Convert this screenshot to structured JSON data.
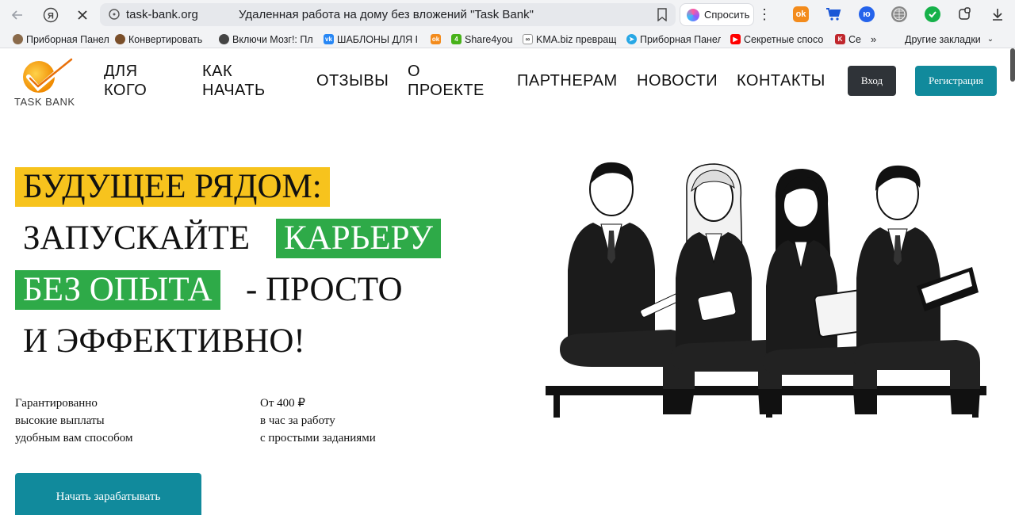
{
  "browser": {
    "url": "task-bank.org",
    "page_title": "Удаленная работа на дому без вложений \"Task Bank\"",
    "ask_label": "Спросить",
    "bookmarks": [
      "Приборная Панел",
      "Конвертировать ",
      "Включи Мозг!: Пл",
      "ШАБЛОНЫ ДЛЯ Р",
      "",
      "Share4you",
      "KMA.biz превращ",
      "Приборная Панел",
      "Секретные спосо",
      "Се",
      "Другие закладки"
    ]
  },
  "site": {
    "logo_text": "TASK BANK",
    "nav": [
      {
        "line1": "ДЛЯ",
        "line2": "КОГО"
      },
      {
        "line1": "КАК",
        "line2": "НАЧАТЬ"
      },
      {
        "line1": "ОТЗЫВЫ",
        "line2": ""
      },
      {
        "line1": "О",
        "line2": "ПРОЕКТЕ"
      },
      {
        "line1": "ПАРТНЕРАМ",
        "line2": ""
      },
      {
        "line1": "НОВОСТИ",
        "line2": ""
      },
      {
        "line1": "КОНТАКТЫ",
        "line2": ""
      }
    ],
    "login_label": "Вход",
    "register_label": "Регистрация"
  },
  "hero": {
    "line1": "БУДУЩЕЕ РЯДОМ:",
    "line2a": "ЗАПУСКАЙТЕ",
    "line2b": "КАРЬЕРУ",
    "line3a": "БЕЗ ОПЫТА",
    "line3b": "- ПРОСТО",
    "line4": "И ЭФФЕКТИВНО!",
    "benefit1": [
      "Гарантированно",
      "высокие выплаты",
      "удобным вам способом"
    ],
    "benefit2": [
      "От 400 ₽",
      "в час за работу",
      "с простыми заданиями"
    ],
    "cta_label": "Начать зарабатывать"
  },
  "colors": {
    "accent_teal": "#118a9c",
    "highlight_yellow": "#f7c31d",
    "highlight_green": "#2eaa48",
    "dark_button": "#2f3338"
  }
}
